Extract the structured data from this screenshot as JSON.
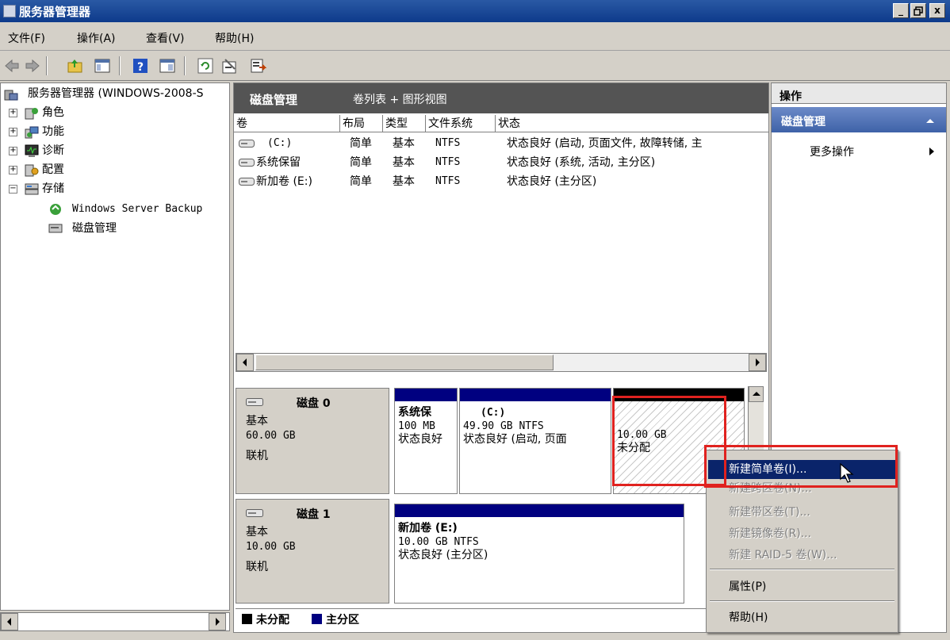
{
  "window": {
    "title": "服务器管理器",
    "minimize": "_",
    "maximize": "▫",
    "close": "x"
  },
  "menu": [
    "文件(F)",
    "操作(A)",
    "查看(V)",
    "帮助(H)"
  ],
  "toolbar_icons": [
    "back-icon",
    "forward-icon",
    "up-folder-icon",
    "show-hide-tree-icon",
    "help-icon",
    "panel-icon",
    "refresh-icon",
    "properties-icon",
    "export-icon"
  ],
  "tree": {
    "root": "服务器管理器 (WINDOWS-2008-S",
    "items": [
      {
        "label": "角色",
        "expander": "+"
      },
      {
        "label": "功能",
        "expander": "+"
      },
      {
        "label": "诊断",
        "expander": "+"
      },
      {
        "label": "配置",
        "expander": "+"
      },
      {
        "label": "存储",
        "expander": "−"
      }
    ],
    "children": [
      "Windows Server Backup",
      "磁盘管理"
    ]
  },
  "center": {
    "title": "磁盘管理",
    "subtitle": "卷列表 + 图形视图",
    "columns": [
      "卷",
      "布局",
      "类型",
      "文件系统",
      "状态"
    ],
    "volumes": [
      {
        "name": "(C:)",
        "layout": "简单",
        "type": "基本",
        "fs": "NTFS",
        "status": "状态良好 (启动, 页面文件, 故障转储, 主"
      },
      {
        "name": "系统保留",
        "layout": "简单",
        "type": "基本",
        "fs": "NTFS",
        "status": "状态良好 (系统, 活动, 主分区)"
      },
      {
        "name": "新加卷 (E:)",
        "layout": "简单",
        "type": "基本",
        "fs": "NTFS",
        "status": "状态良好 (主分区)"
      }
    ]
  },
  "disks": [
    {
      "name": "磁盘 0",
      "kind": "基本",
      "size": "60.00 GB",
      "state": "联机",
      "partitions": [
        {
          "title": "系统保",
          "size": "100 MB",
          "status": "状态良好"
        },
        {
          "title": "(C:)",
          "size": "49.90 GB NTFS",
          "status": "状态良好 (启动, 页面"
        },
        {
          "title": "",
          "size": "10.00 GB",
          "status": "未分配"
        }
      ]
    },
    {
      "name": "磁盘 1",
      "kind": "基本",
      "size": "10.00 GB",
      "state": "联机",
      "partitions": [
        {
          "title": "新加卷  (E:)",
          "size": "10.00 GB NTFS",
          "status": "状态良好 (主分区)"
        }
      ]
    }
  ],
  "legend": {
    "unallocated": "未分配",
    "primary": "主分区",
    "unallocated_color": "#000000",
    "primary_color": "#000080"
  },
  "actions": {
    "header": "操作",
    "section": "磁盘管理",
    "more": "更多操作"
  },
  "context_menu": {
    "items": [
      "新建简单卷(I)...",
      "新建跨区卷(N)...",
      "新建带区卷(T)...",
      "新建镜像卷(R)...",
      "新建 RAID-5 卷(W)..."
    ],
    "properties": "属性(P)",
    "help": "帮助(H)"
  }
}
